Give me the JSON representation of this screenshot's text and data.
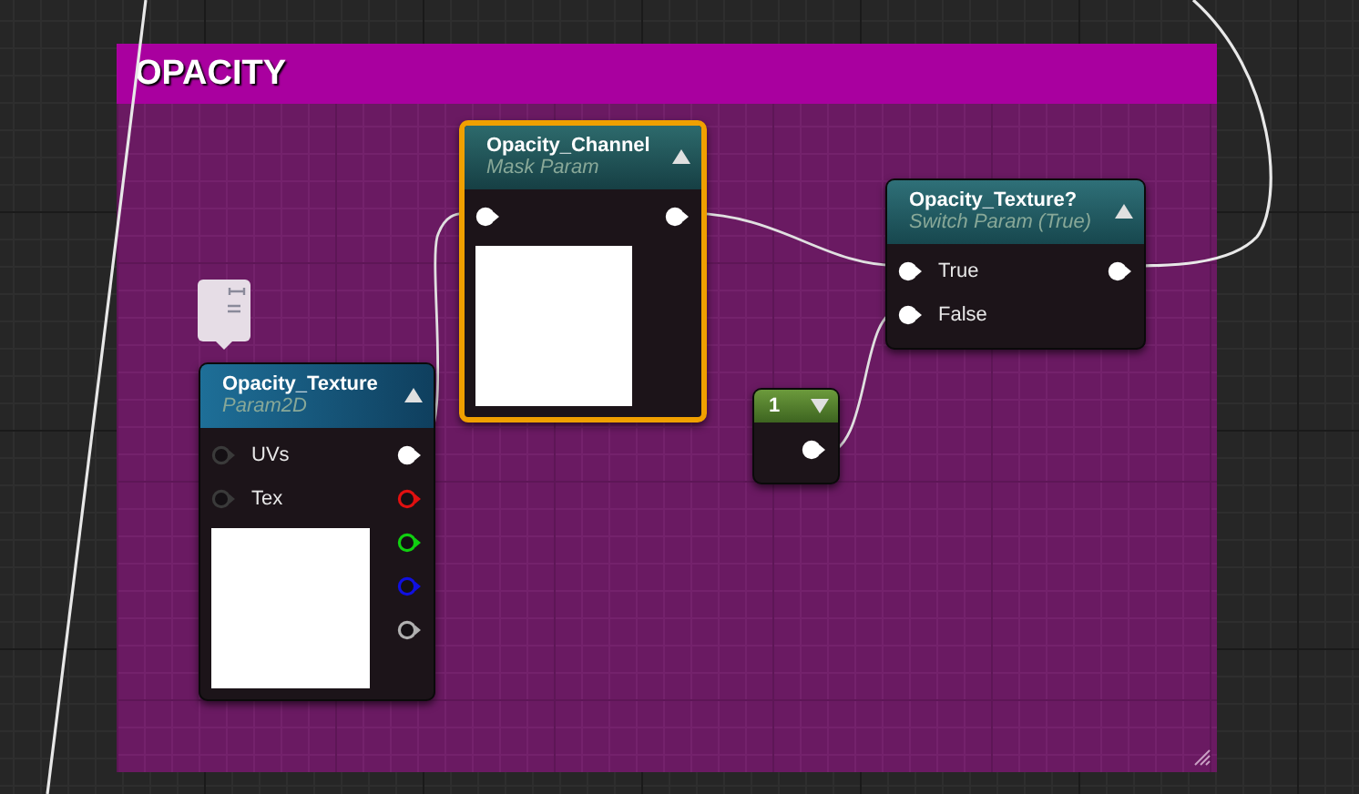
{
  "comment": {
    "title": "OPACITY"
  },
  "nodes": [
    {
      "kind": "mask_param",
      "title": "Opacity_Channel",
      "subtitle": "Mask Param",
      "selected": true,
      "preview": true,
      "inputs": [
        {
          "connected": true
        }
      ],
      "outputs": [
        {
          "connected": true,
          "color": "#ffffff"
        }
      ]
    },
    {
      "kind": "switch_param",
      "title": "Opacity_Texture?",
      "subtitle": "Switch Param (True)",
      "selected": false,
      "preview": false,
      "inputs": [
        {
          "label": "True",
          "connected": true
        },
        {
          "label": "False",
          "connected": true
        }
      ],
      "outputs": [
        {
          "connected": true,
          "color": "#ffffff"
        }
      ]
    },
    {
      "kind": "constant",
      "title": "1",
      "selected": false,
      "preview": false,
      "outputs": [
        {
          "connected": true,
          "color": "#ffffff"
        }
      ]
    },
    {
      "kind": "texture_param",
      "title": "Opacity_Texture",
      "subtitle": "Param2D",
      "selected": false,
      "preview": true,
      "inputs": [
        {
          "label": "UVs",
          "connected": false
        },
        {
          "label": "Tex",
          "connected": false
        }
      ],
      "outputs": [
        {
          "connected": true,
          "color": "#ffffff"
        },
        {
          "connected": false,
          "color": "#e01010"
        },
        {
          "connected": false,
          "color": "#10d010"
        },
        {
          "connected": false,
          "color": "#1010e0"
        },
        {
          "connected": false,
          "color": "#b0b0b0"
        }
      ]
    }
  ]
}
